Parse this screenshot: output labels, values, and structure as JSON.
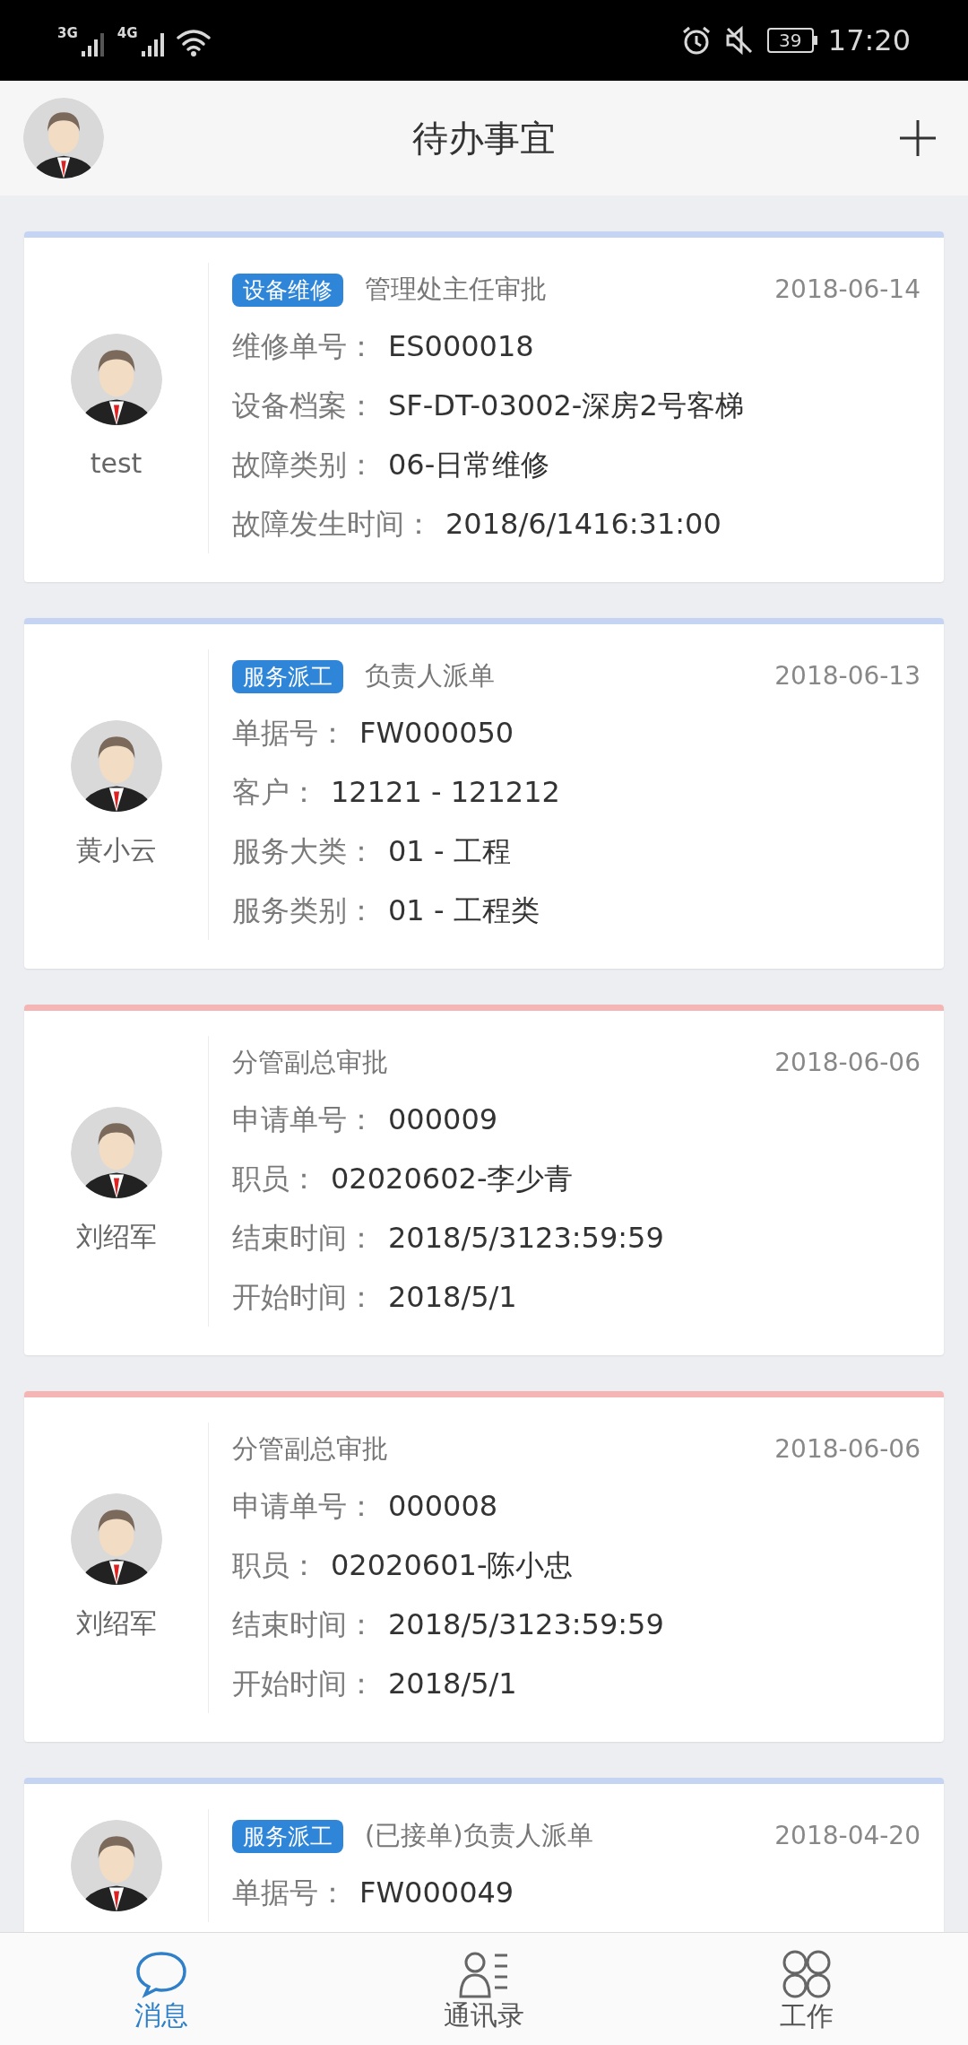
{
  "status_bar": {
    "network_1": "3G",
    "network_2": "4G",
    "battery": "39",
    "time": "17:20"
  },
  "header": {
    "title": "待办事宜"
  },
  "cards": [
    {
      "color": "#c5d4f2",
      "name": "test",
      "tag": "设备维修",
      "step": "管理处主任审批",
      "date": "2018-06-14",
      "fields": [
        {
          "label": "维修单号：",
          "value": "ES000018"
        },
        {
          "label": "设备档案：",
          "value": "SF-DT-03002-深房2号客梯"
        },
        {
          "label": "故障类别：",
          "value": "06-日常维修"
        },
        {
          "label": "故障发生时间：",
          "value": "2018/6/1416:31:00"
        }
      ]
    },
    {
      "color": "#c5d4f2",
      "name": "黄小云",
      "tag": "服务派工",
      "step": "负责人派单",
      "date": "2018-06-13",
      "fields": [
        {
          "label": "单据号：",
          "value": "FW000050"
        },
        {
          "label": "客户：",
          "value": "12121 - 121212"
        },
        {
          "label": "服务大类：",
          "value": "01 - 工程"
        },
        {
          "label": "服务类别：",
          "value": "01 - 工程类"
        }
      ]
    },
    {
      "color": "#f5b5b5",
      "name": "刘绍军",
      "step": "分管副总审批",
      "date": "2018-06-06",
      "fields": [
        {
          "label": "申请单号：",
          "value": "000009"
        },
        {
          "label": "职员：",
          "value": "02020602-李少青"
        },
        {
          "label": "结束时间：",
          "value": "2018/5/3123:59:59"
        },
        {
          "label": "开始时间：",
          "value": "2018/5/1"
        }
      ]
    },
    {
      "color": "#f5b5b5",
      "name": "刘绍军",
      "step": "分管副总审批",
      "date": "2018-06-06",
      "fields": [
        {
          "label": "申请单号：",
          "value": "000008"
        },
        {
          "label": "职员：",
          "value": "02020601-陈小忠"
        },
        {
          "label": "结束时间：",
          "value": "2018/5/3123:59:59"
        },
        {
          "label": "开始时间：",
          "value": "2018/5/1"
        }
      ]
    },
    {
      "color": "#c5d4f2",
      "tag": "服务派工",
      "step": "(已接单)负责人派单",
      "date": "2018-04-20",
      "fields": [
        {
          "label": "单据号：",
          "value": "FW000049"
        }
      ]
    }
  ],
  "tabs": [
    {
      "kind": "chat",
      "label": "消息",
      "selected": true
    },
    {
      "kind": "contacts",
      "label": "通讯录",
      "selected": false
    },
    {
      "kind": "apps",
      "label": "工作",
      "selected": false
    }
  ]
}
